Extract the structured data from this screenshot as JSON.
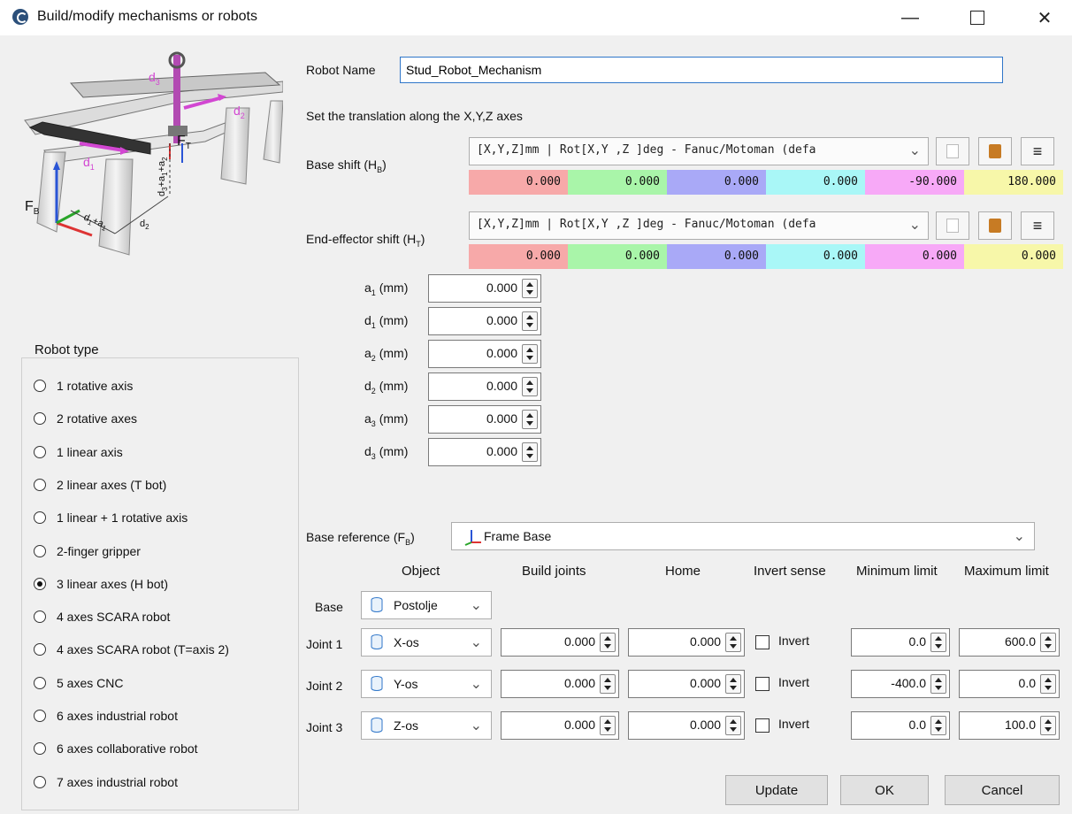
{
  "window": {
    "title": "Build/modify mechanisms or robots",
    "minimize_icon": "minimize-icon",
    "maximize_icon": "maximize-icon",
    "close_icon": "close-icon"
  },
  "robot_name": {
    "label": "Robot Name",
    "value": "Stud_Robot_Mechanism"
  },
  "translation_label": "Set the translation along the X,Y,Z axes",
  "base_shift": {
    "label": "Base shift (H",
    "label_sub": "B",
    "label_end": ")",
    "format": "[X,Y,Z]mm | Rot[X,Y ,Z  ]deg - Fanuc/Motoman (defa",
    "values": [
      "0.000",
      "0.000",
      "0.000",
      "0.000",
      "-90.000",
      "180.000"
    ]
  },
  "end_effector_shift": {
    "label": "End-effector shift (H",
    "label_sub": "T",
    "label_end": ")",
    "format": "[X,Y,Z]mm | Rot[X,Y ,Z  ]deg - Fanuc/Motoman (defa",
    "values": [
      "0.000",
      "0.000",
      "0.000",
      "0.000",
      "0.000",
      "0.000"
    ]
  },
  "value_colors": [
    "#f7a9a9",
    "#a9f5a9",
    "#a9a9f7",
    "#a9f7f7",
    "#f7a9f7",
    "#f7f7a9"
  ],
  "diagram": {
    "labels": {
      "d3": "d",
      "d3_sub": "3",
      "d2": "d",
      "d2_sub": "2",
      "d1": "d",
      "d1_sub": "1",
      "ft": "F",
      "ft_sub": "T",
      "fb": "F",
      "fb_sub": "B",
      "d2b": "d",
      "d2b_sub": "2",
      "d1a": "d",
      "d1a_sub": "1",
      "d1a_rest": "+a",
      "d1a_rest_sub": "1",
      "dz": "d",
      "dz_sub": "3",
      "dz_rest": "+a",
      "dz_rest_sub": "1",
      "dz_rest2": "+a",
      "dz_rest2_sub": "2"
    }
  },
  "params": [
    {
      "label": "a",
      "sub": "1",
      "unit": " (mm)",
      "value": "0.000"
    },
    {
      "label": "d",
      "sub": "1",
      "unit": " (mm)",
      "value": "0.000"
    },
    {
      "label": "a",
      "sub": "2",
      "unit": " (mm)",
      "value": "0.000"
    },
    {
      "label": "d",
      "sub": "2",
      "unit": " (mm)",
      "value": "0.000"
    },
    {
      "label": "a",
      "sub": "3",
      "unit": " (mm)",
      "value": "0.000"
    },
    {
      "label": "d",
      "sub": "3",
      "unit": " (mm)",
      "value": "0.000"
    }
  ],
  "robot_type": {
    "title": "Robot type",
    "options": [
      {
        "label": "1 rotative axis",
        "selected": false
      },
      {
        "label": "2 rotative axes",
        "selected": false
      },
      {
        "label": "1 linear axis",
        "selected": false
      },
      {
        "label": "2 linear axes (T bot)",
        "selected": false
      },
      {
        "label": "1 linear + 1 rotative axis",
        "selected": false
      },
      {
        "label": "2-finger gripper",
        "selected": false
      },
      {
        "label": "3 linear axes (H bot)",
        "selected": true
      },
      {
        "label": "4 axes SCARA robot",
        "selected": false
      },
      {
        "label": "4 axes SCARA robot (T=axis 2)",
        "selected": false
      },
      {
        "label": "5 axes CNC",
        "selected": false
      },
      {
        "label": "6 axes industrial robot",
        "selected": false
      },
      {
        "label": "6 axes collaborative robot",
        "selected": false
      },
      {
        "label": "7 axes industrial robot",
        "selected": false
      }
    ]
  },
  "base_reference": {
    "label": "Base reference (F",
    "label_sub": "B",
    "label_end": ")",
    "value": "Frame Base"
  },
  "joints_table": {
    "headers": [
      "Object",
      "Build joints",
      "Home",
      "Invert sense",
      "Minimum limit",
      "Maximum limit"
    ],
    "base_row": {
      "label": "Base",
      "object": "Postolje"
    },
    "rows": [
      {
        "label": "Joint 1",
        "object": "X-os",
        "build": "0.000",
        "home": "0.000",
        "invert_label": "Invert",
        "invert": false,
        "min": "0.0",
        "max": "600.0"
      },
      {
        "label": "Joint 2",
        "object": "Y-os",
        "build": "0.000",
        "home": "0.000",
        "invert_label": "Invert",
        "invert": false,
        "min": "-400.0",
        "max": "0.0"
      },
      {
        "label": "Joint 3",
        "object": "Z-os",
        "build": "0.000",
        "home": "0.000",
        "invert_label": "Invert",
        "invert": false,
        "min": "0.0",
        "max": "100.0"
      }
    ]
  },
  "buttons": {
    "update": "Update",
    "ok": "OK",
    "cancel": "Cancel"
  }
}
